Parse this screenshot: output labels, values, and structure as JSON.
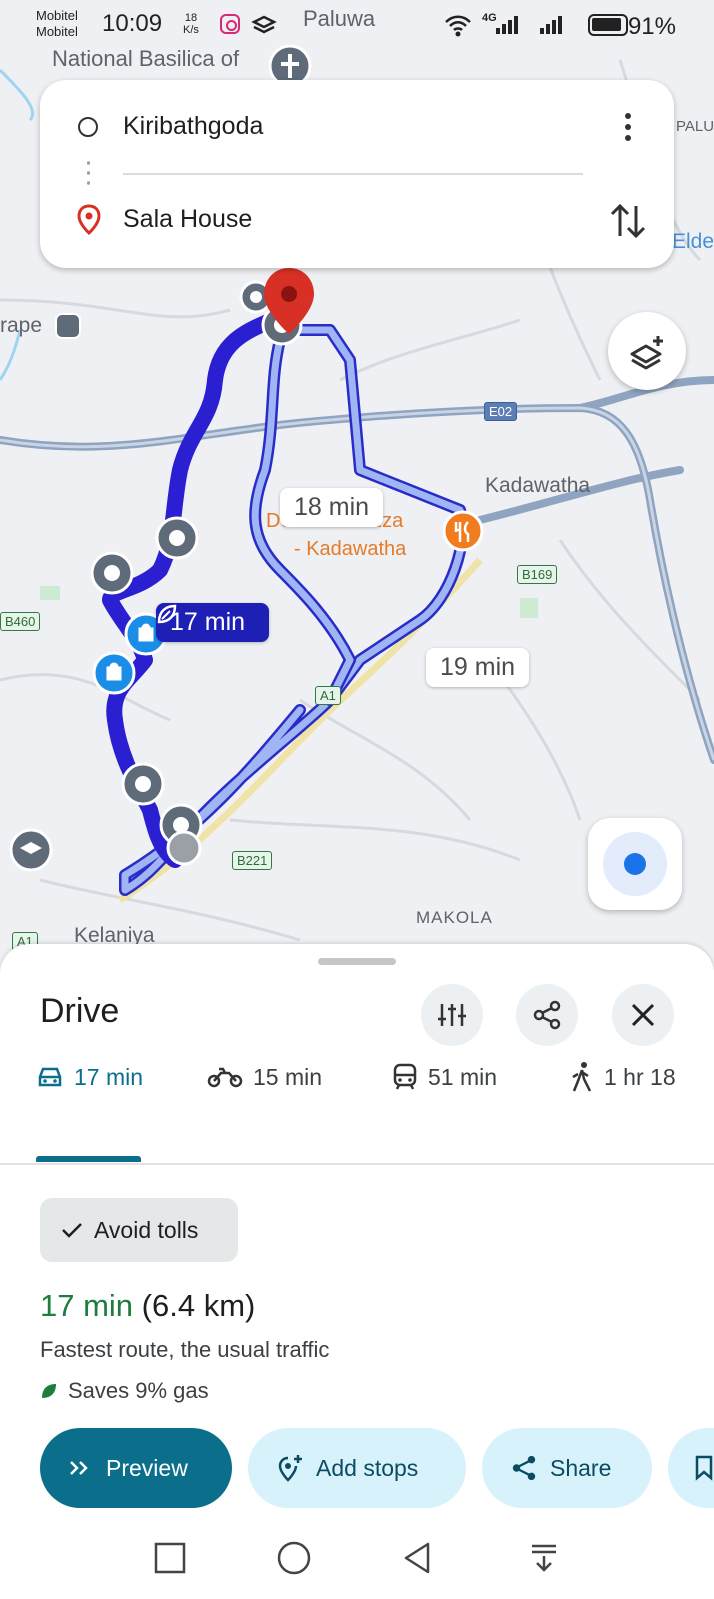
{
  "status_bar": {
    "carrier1": "Mobitel",
    "carrier2": "Mobitel",
    "time": "10:09",
    "speed_value": "18",
    "speed_unit": "K/s",
    "network": "4G",
    "battery": "91%"
  },
  "route_inputs": {
    "origin": "Kiribathgoda",
    "destination": "Sala House"
  },
  "map": {
    "place_labels": {
      "paluwa": "Paluwa",
      "basilica": "National Basilica of",
      "kadawatha": "Kadawatha",
      "dominos_1": "Domino's Pizza",
      "dominos_2": "- Kadawatha",
      "makola": "MAKOLA",
      "kelaniya": "Kelaniya",
      "rape": "rape",
      "palu": "PALU",
      "elde": "Elde"
    },
    "road_shields": {
      "e02": "E02",
      "b169": "B169",
      "a1": "A1",
      "a1_left": "A1",
      "b221": "B221",
      "b460": "B460"
    },
    "route_times": {
      "selected": "17 min",
      "alt1": "18 min",
      "alt2": "19 min"
    },
    "colors": {
      "selected_route": "#2a1fd1",
      "alt_route": "#9fb5f4",
      "pin": "#d93025",
      "restaurant": "#f07c1f"
    }
  },
  "sheet": {
    "title": "Drive",
    "modes": [
      {
        "icon": "car-icon",
        "label": "17 min",
        "active": true
      },
      {
        "icon": "motorcycle-icon",
        "label": "15 min",
        "active": false
      },
      {
        "icon": "transit-icon",
        "label": "51 min",
        "active": false
      },
      {
        "icon": "walk-icon",
        "label": "1 hr 18",
        "active": false
      }
    ],
    "avoid_chip": "Avoid tolls",
    "route_time": "17 min",
    "route_distance": "(6.4 km)",
    "route_description": "Fastest route, the usual traffic",
    "route_gas": "Saves 9% gas",
    "actions": {
      "preview": "Preview",
      "add_stops": "Add stops",
      "share": "Share"
    }
  }
}
